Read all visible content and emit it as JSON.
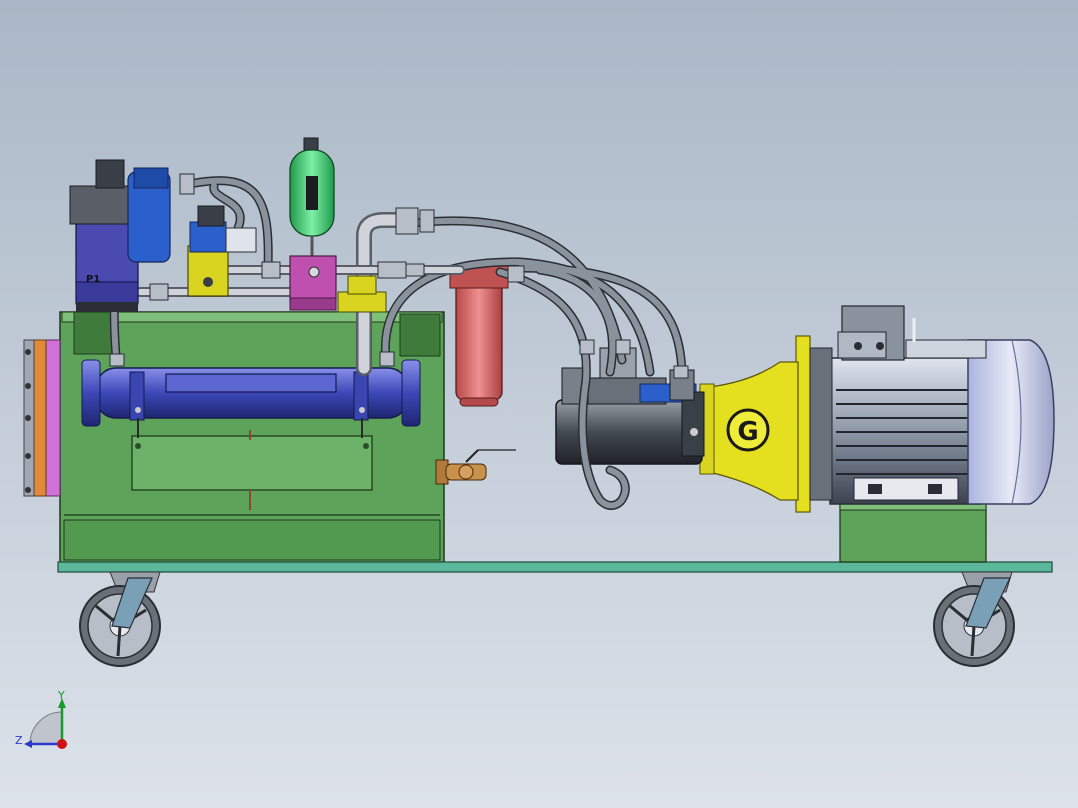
{
  "viewport": {
    "background_top": "#a9b7c6",
    "background_bottom": "#dde2ea"
  },
  "labels": {
    "pump_tag": "P1",
    "coupling_mark": "G",
    "axis_y": "Y",
    "axis_z": "Z"
  },
  "colors": {
    "tank_green": "#5ea35a",
    "base_plate": "#5bb89b",
    "motor_grey": "#8e98a8",
    "bell_yellow": "#e4e020",
    "filter_red": "#d86a6a",
    "accumulator_green": "#44d47a",
    "valve_blue": "#2a5fcc",
    "manifold_magenta": "#c050b0",
    "flange_orange": "#e08a3a",
    "flange_pink": "#d070d8",
    "hose_grey": "#6c727a",
    "cooler_blue": "#4b5bc8",
    "axis_y_color": "#1a9a2a",
    "axis_z_color": "#2a3ad0",
    "axis_x_color": "#d01010"
  },
  "components": [
    {
      "name": "oil-tank",
      "icon": "tank-icon"
    },
    {
      "name": "electric-motor",
      "icon": "motor-icon"
    },
    {
      "name": "pump",
      "icon": "pump-icon"
    },
    {
      "name": "bell-housing",
      "icon": "coupling-icon"
    },
    {
      "name": "return-filter",
      "icon": "filter-icon"
    },
    {
      "name": "accumulator",
      "icon": "accumulator-icon"
    },
    {
      "name": "oil-cooler",
      "icon": "cooler-icon"
    },
    {
      "name": "caster-wheel-left",
      "icon": "wheel-icon"
    },
    {
      "name": "caster-wheel-right",
      "icon": "wheel-icon"
    }
  ]
}
